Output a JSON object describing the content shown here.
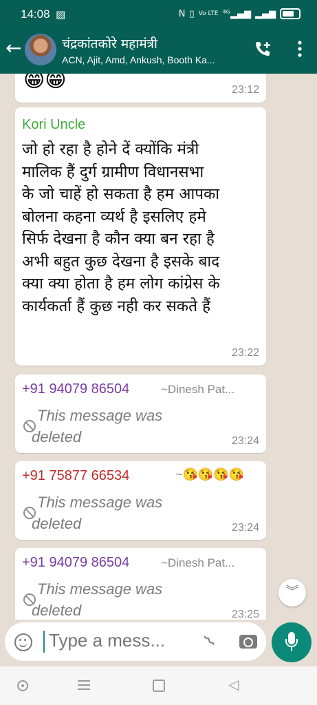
{
  "status_bar": {
    "time": "14:08",
    "left_icon": "gallery-notification-icon",
    "right_icons": [
      "nfc-icon",
      "vibrate-icon",
      "volte-icon",
      "4g-signal-icon",
      "signal-icon",
      "battery-icon"
    ]
  },
  "header": {
    "title": "चंद्रकांतकोरे महामंत्री",
    "subtitle": "ACN, Ajit, Amd, Ankush, Booth Ka...",
    "accent_color": "#075e54"
  },
  "messages": [
    {
      "type": "emoji",
      "content": "😁😁",
      "time": "23:12"
    },
    {
      "type": "text",
      "sender": "Kori Uncle",
      "sender_color": "#3fae3a",
      "lines": [
        "जो हो रहा है होने दें क्योंकि मंत्री",
        "मालिक हैं दुर्ग ग्रामीण विधानसभा",
        "के जो चाहें हो सकता है हम आपका",
        "बोलना कहना व्यर्थ है इसलिए हमे",
        "सिर्फ देखना है कौन क्या बन रहा है",
        "अभी बहुत कुछ देखना है इसके बाद",
        "क्या क्या होता है हम लोग कांग्रेस के",
        "कार्यकर्ता हैं कुछ नही कर सकते हैं"
      ],
      "time": "23:22"
    },
    {
      "type": "deleted",
      "sender": "+91 94079 86504",
      "sender_color": "#7a3ba3",
      "alias": "~Dinesh Pat...",
      "deleted_line1": "This message was",
      "deleted_line2": "deleted",
      "time": "23:24"
    },
    {
      "type": "deleted",
      "sender": "+91 75877 66534",
      "sender_color": "#c12a2a",
      "alias": "~😘😘😘😘",
      "deleted_line1": "This message was",
      "deleted_line2": "deleted",
      "time": "23:24"
    },
    {
      "type": "deleted",
      "sender": "+91 94079 86504",
      "sender_color": "#7a3ba3",
      "alias": "~Dinesh Pat...",
      "deleted_line1": "This message was",
      "deleted_line2": "deleted",
      "time": "23:25"
    }
  ],
  "input": {
    "placeholder": "Type a mess..."
  },
  "icons": {
    "back": "back-arrow-icon",
    "call": "add-call-icon",
    "menu": "more-vertical-icon",
    "scroll": "double-chevron-down-icon",
    "emoji": "emoji-icon",
    "attach": "paperclip-icon",
    "camera": "camera-icon",
    "mic": "microphone-icon"
  },
  "nav_bar": [
    "home-circle-icon",
    "menu-lines-icon",
    "square-icon",
    "back-triangle-icon"
  ]
}
